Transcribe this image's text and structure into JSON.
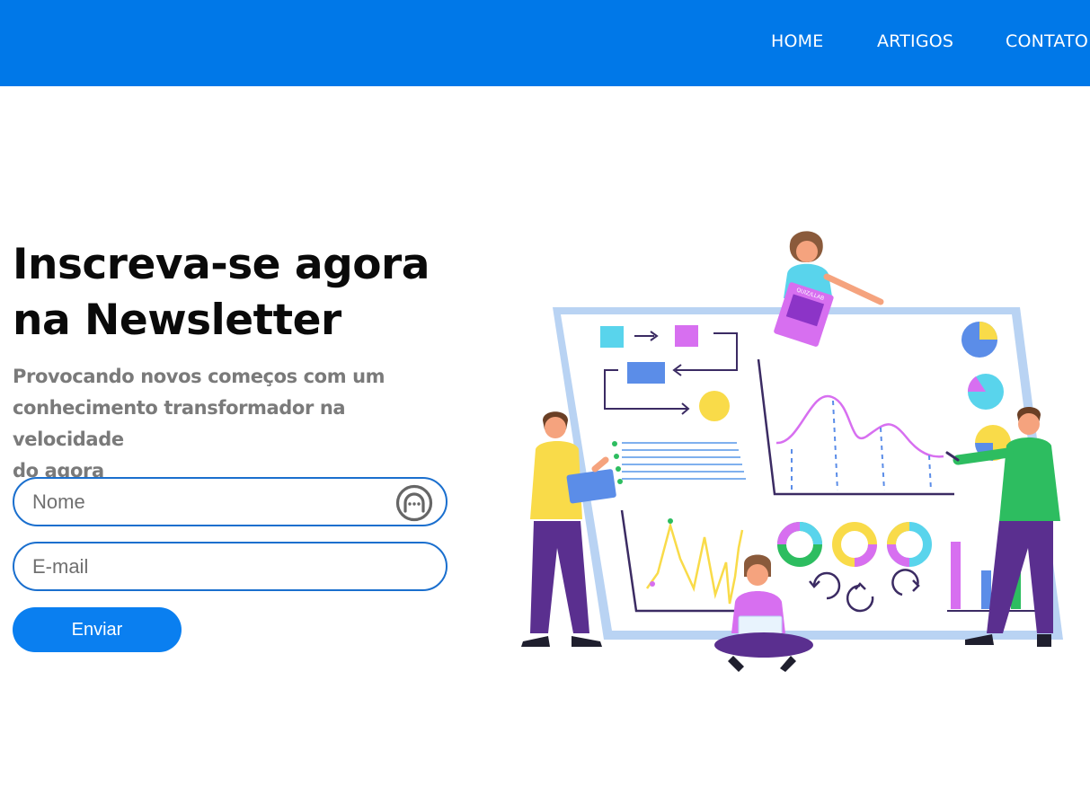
{
  "nav": {
    "items": [
      {
        "label": "HOME"
      },
      {
        "label": "ARTIGOS"
      },
      {
        "label": "CONTATO"
      }
    ]
  },
  "hero": {
    "title_line1": "Inscreva-se agora",
    "title_line2": "na Newsletter",
    "subtitle_line1": "Provocando novos começos com um",
    "subtitle_line2": "conhecimento transformador na velocidade",
    "subtitle_line3": "do agora"
  },
  "form": {
    "name_placeholder": "Nome",
    "email_placeholder": "E-mail",
    "submit_label": "Enviar"
  },
  "illustration": {
    "sticker_text": "QUIZ/LLAB"
  },
  "colors": {
    "header_bg": "#0078e8",
    "button_bg": "#0a7ff0",
    "field_border": "#1a6fce",
    "title_text": "#0a0a0a",
    "subtitle_text": "#7a7a7a"
  },
  "icons": {
    "name_field_icon": "password-manager-icon"
  }
}
